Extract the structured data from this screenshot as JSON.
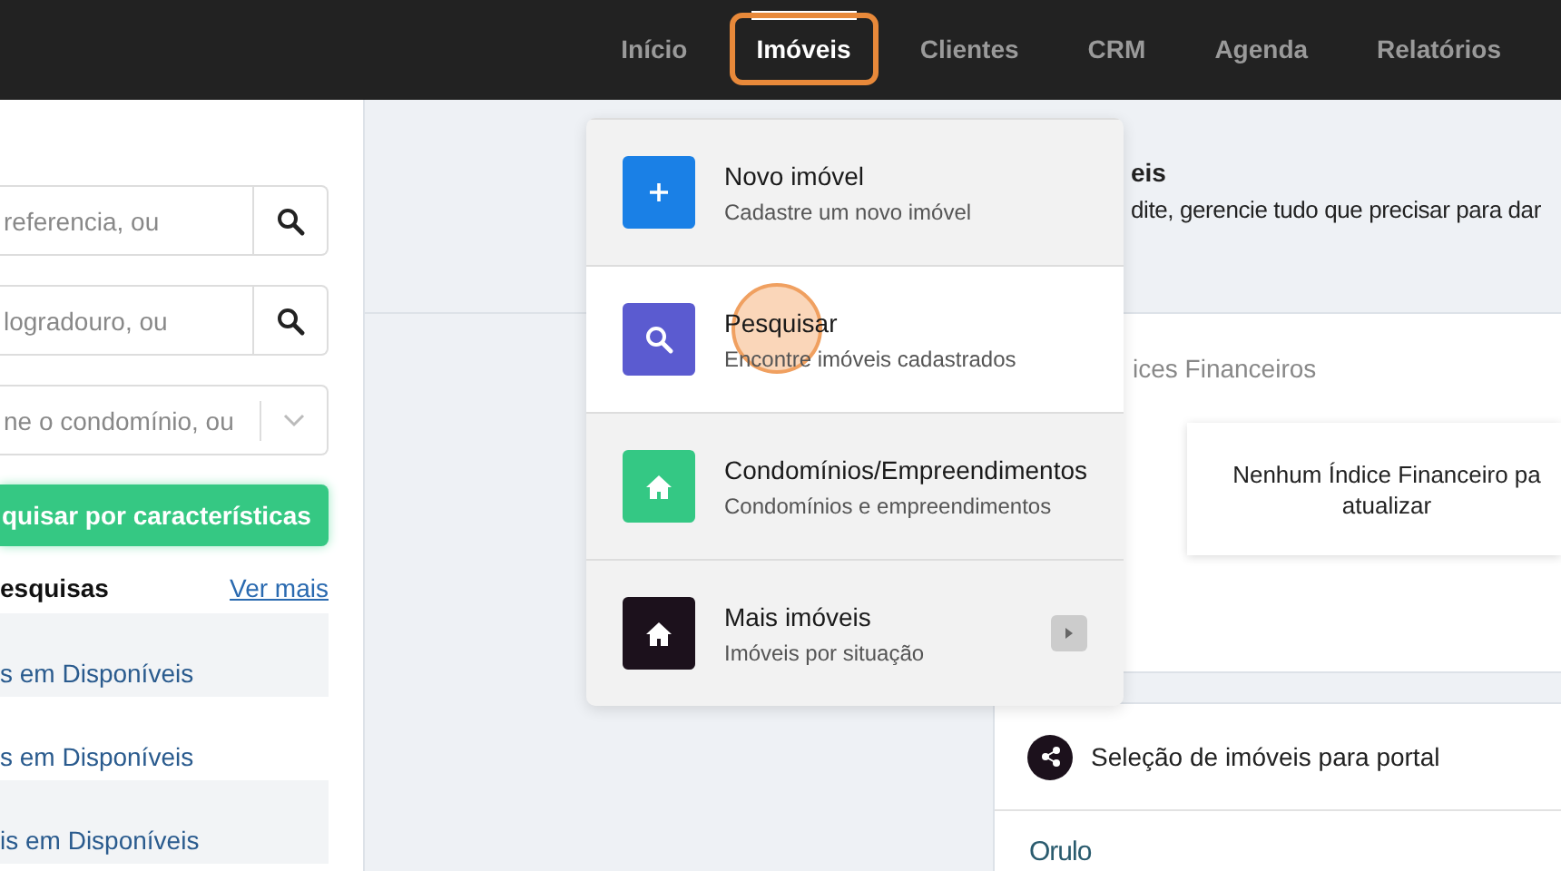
{
  "nav": {
    "items": [
      {
        "label": "Início",
        "selected": false,
        "highlighted": false
      },
      {
        "label": "Imóveis",
        "selected": true,
        "highlighted": true
      },
      {
        "label": "Clientes",
        "selected": false,
        "highlighted": false
      },
      {
        "label": "CRM",
        "selected": false,
        "highlighted": false
      },
      {
        "label": "Agenda",
        "selected": false,
        "highlighted": false
      },
      {
        "label": "Relatórios",
        "selected": false,
        "highlighted": false
      }
    ]
  },
  "sidebar": {
    "fields": [
      {
        "kind": "search",
        "placeholder": "referencia, ou"
      },
      {
        "kind": "search",
        "placeholder": "logradouro, ou"
      },
      {
        "kind": "select",
        "placeholder": "ne o condomínio, ou"
      }
    ],
    "action_button": "quisar por características",
    "recent": {
      "title": "esquisas",
      "link": "Ver mais",
      "items": [
        "s em Disponíveis",
        "s em Disponíveis",
        "is em Disponíveis"
      ]
    }
  },
  "page_header": {
    "title": "eis",
    "subtitle": "dite, gerencie tudo que precisar para dar"
  },
  "financial_card": {
    "title": "ices Financeiros",
    "empty_message": "Nenhum Índice Financeiro pa\natualizar"
  },
  "portal_card": {
    "title": "Seleção de imóveis para portal",
    "logo": "Orulo"
  },
  "menu": {
    "items": [
      {
        "title": "Novo imóvel",
        "subtitle": "Cadastre um novo imóvel",
        "kind": "add",
        "color": "#1a80e6",
        "selected": false,
        "has_submenu": false
      },
      {
        "title": "Pesquisar",
        "subtitle": "Encontre imóveis cadastrados",
        "kind": "search",
        "color": "#5b5bd0",
        "selected": true,
        "has_submenu": false
      },
      {
        "title": "Condomínios/Empreendimentos",
        "subtitle": "Condomínios e empreendimentos",
        "kind": "home",
        "color": "#34c884",
        "selected": false,
        "has_submenu": false
      },
      {
        "title": "Mais imóveis",
        "subtitle": "Imóveis por situação",
        "kind": "home",
        "color": "#1c111c",
        "selected": false,
        "has_submenu": true
      }
    ]
  }
}
